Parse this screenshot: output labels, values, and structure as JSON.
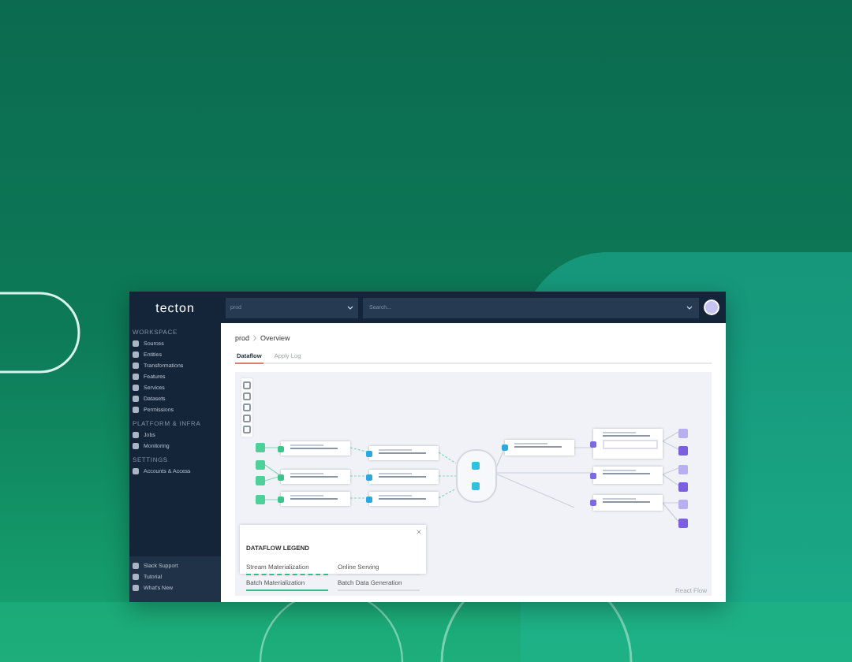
{
  "brand": "tecton",
  "workspace": {
    "value": "prod"
  },
  "search": {
    "placeholder": "Search..."
  },
  "sidebar": {
    "sections": [
      {
        "heading": "WORKSPACE",
        "items": [
          {
            "label": "Sources",
            "selected": false
          },
          {
            "label": "Entities",
            "selected": false
          },
          {
            "label": "Transformations",
            "selected": false
          },
          {
            "label": "Features",
            "selected": false
          },
          {
            "label": "Services",
            "selected": false
          },
          {
            "label": "Datasets",
            "selected": false
          },
          {
            "label": "Permissions",
            "selected": false
          }
        ]
      },
      {
        "heading": "PLATFORM & INFRA",
        "items": [
          {
            "label": "Jobs",
            "selected": false
          },
          {
            "label": "Monitoring",
            "selected": false
          }
        ]
      },
      {
        "heading": "SETTINGS",
        "items": [
          {
            "label": "Accounts & Access",
            "selected": false
          }
        ]
      }
    ],
    "footer": [
      {
        "label": "Slack Support"
      },
      {
        "label": "Tutorial"
      },
      {
        "label": "What's New"
      }
    ]
  },
  "breadcrumb": [
    "prod",
    "Overview"
  ],
  "tabs": [
    {
      "label": "Dataflow",
      "selected": true
    },
    {
      "label": "Apply Log",
      "selected": false
    }
  ],
  "legend": {
    "title": "DATAFLOW LEGEND",
    "items": [
      {
        "label": "Stream Materialization",
        "kind": "stream"
      },
      {
        "label": "Online Serving",
        "kind": "serving"
      },
      {
        "label": "Batch Materialization",
        "kind": "batch"
      },
      {
        "label": "Batch Data Generation",
        "kind": "generation"
      }
    ]
  },
  "attribution": "React Flow"
}
